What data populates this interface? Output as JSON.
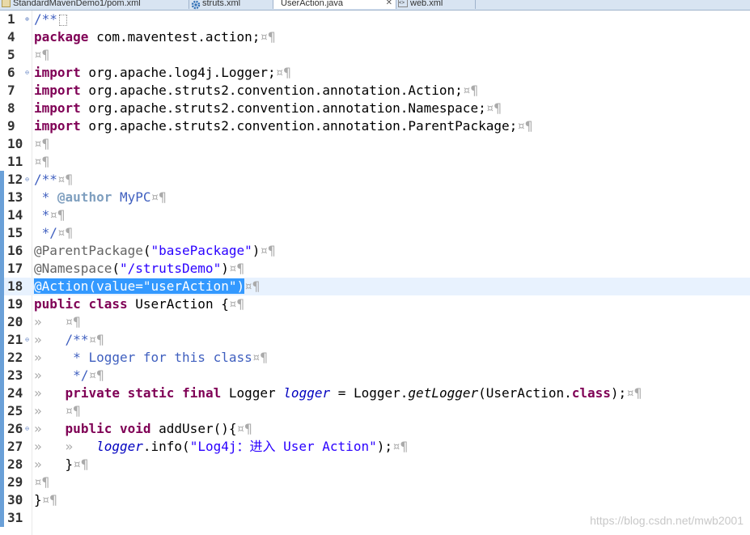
{
  "tabs": [
    {
      "label": "StandardMavenDemo1/pom.xml",
      "icon": "xml-file-icon",
      "active": false
    },
    {
      "label": "struts.xml",
      "icon": "gear-file-icon",
      "active": false
    },
    {
      "label": "UserAction.java",
      "icon": "java-file-icon",
      "active": true
    },
    {
      "label": "web.xml",
      "icon": "xml-file-icon",
      "active": false
    }
  ],
  "tab_close": "✕",
  "ws_mark": "¤¶",
  "tab_mark": "»",
  "lines": [
    {
      "num": "1",
      "fold": "plus"
    },
    {
      "num": "4",
      "fold": ""
    },
    {
      "num": "5",
      "fold": ""
    },
    {
      "num": "6",
      "fold": "minus"
    },
    {
      "num": "7",
      "fold": ""
    },
    {
      "num": "8",
      "fold": ""
    },
    {
      "num": "9",
      "fold": ""
    },
    {
      "num": "10",
      "fold": ""
    },
    {
      "num": "11",
      "fold": ""
    },
    {
      "num": "12",
      "fold": "minus"
    },
    {
      "num": "13",
      "fold": ""
    },
    {
      "num": "14",
      "fold": ""
    },
    {
      "num": "15",
      "fold": ""
    },
    {
      "num": "16",
      "fold": ""
    },
    {
      "num": "17",
      "fold": ""
    },
    {
      "num": "18",
      "fold": ""
    },
    {
      "num": "19",
      "fold": ""
    },
    {
      "num": "20",
      "fold": ""
    },
    {
      "num": "21",
      "fold": "minus"
    },
    {
      "num": "22",
      "fold": ""
    },
    {
      "num": "23",
      "fold": ""
    },
    {
      "num": "24",
      "fold": ""
    },
    {
      "num": "25",
      "fold": ""
    },
    {
      "num": "26",
      "fold": "minus"
    },
    {
      "num": "27",
      "fold": ""
    },
    {
      "num": "28",
      "fold": ""
    },
    {
      "num": "29",
      "fold": ""
    },
    {
      "num": "30",
      "fold": ""
    },
    {
      "num": "31",
      "fold": ""
    }
  ],
  "code": {
    "l1": "/**",
    "l4_kw": "package",
    "l4_rest": " com.maventest.action;",
    "l6_kw": "import",
    "l6_rest": " org.apache.log4j.Logger;",
    "l7_kw": "import",
    "l7_rest": " org.apache.struts2.convention.annotation.Action;",
    "l8_kw": "import",
    "l8_rest": " org.apache.struts2.convention.annotation.Namespace;",
    "l9_kw": "import",
    "l9_rest": " org.apache.struts2.convention.annotation.ParentPackage;",
    "l12": "/**",
    "l13_pre": " * ",
    "l13_tag": "@author",
    "l13_txt": " MyPC",
    "l14": " *",
    "l15": " */",
    "l16_ann": "@ParentPackage",
    "l16_open": "(",
    "l16_str": "\"basePackage\"",
    "l16_close": ")",
    "l17_ann": "@Namespace",
    "l17_open": "(",
    "l17_str": "\"/strutsDemo\"",
    "l17_close": ")",
    "l18_sel": "@Action(value=\"userAction\")",
    "l19_kw1": "public",
    "l19_kw2": "class",
    "l19_rest": " UserAction {",
    "l21": "/**",
    "l22": " * Logger for this class",
    "l23": " */",
    "l24_kw1": "private",
    "l24_kw2": "static",
    "l24_kw3": "final",
    "l24_type": " Logger ",
    "l24_fld": "logger",
    "l24_eq": " = Logger.",
    "l24_mth": "getLogger",
    "l24_args": "(UserAction.",
    "l24_cls": "class",
    "l24_end": ");",
    "l26_kw1": "public",
    "l26_kw2": "void",
    "l26_rest": " addUser(){",
    "l27_fld": "logger",
    "l27_call": ".info(",
    "l27_str": "\"Log4j：进入 User Action\"",
    "l27_end": ");",
    "l28": "}",
    "l30": "}"
  },
  "watermark": "https://blog.csdn.net/mwb2001",
  "colors": {
    "keyword": "#7f0055",
    "string": "#2a00ff",
    "comment": "#3f5fbf",
    "selection": "#3399ff",
    "line_highlight": "#e8f2fe"
  }
}
